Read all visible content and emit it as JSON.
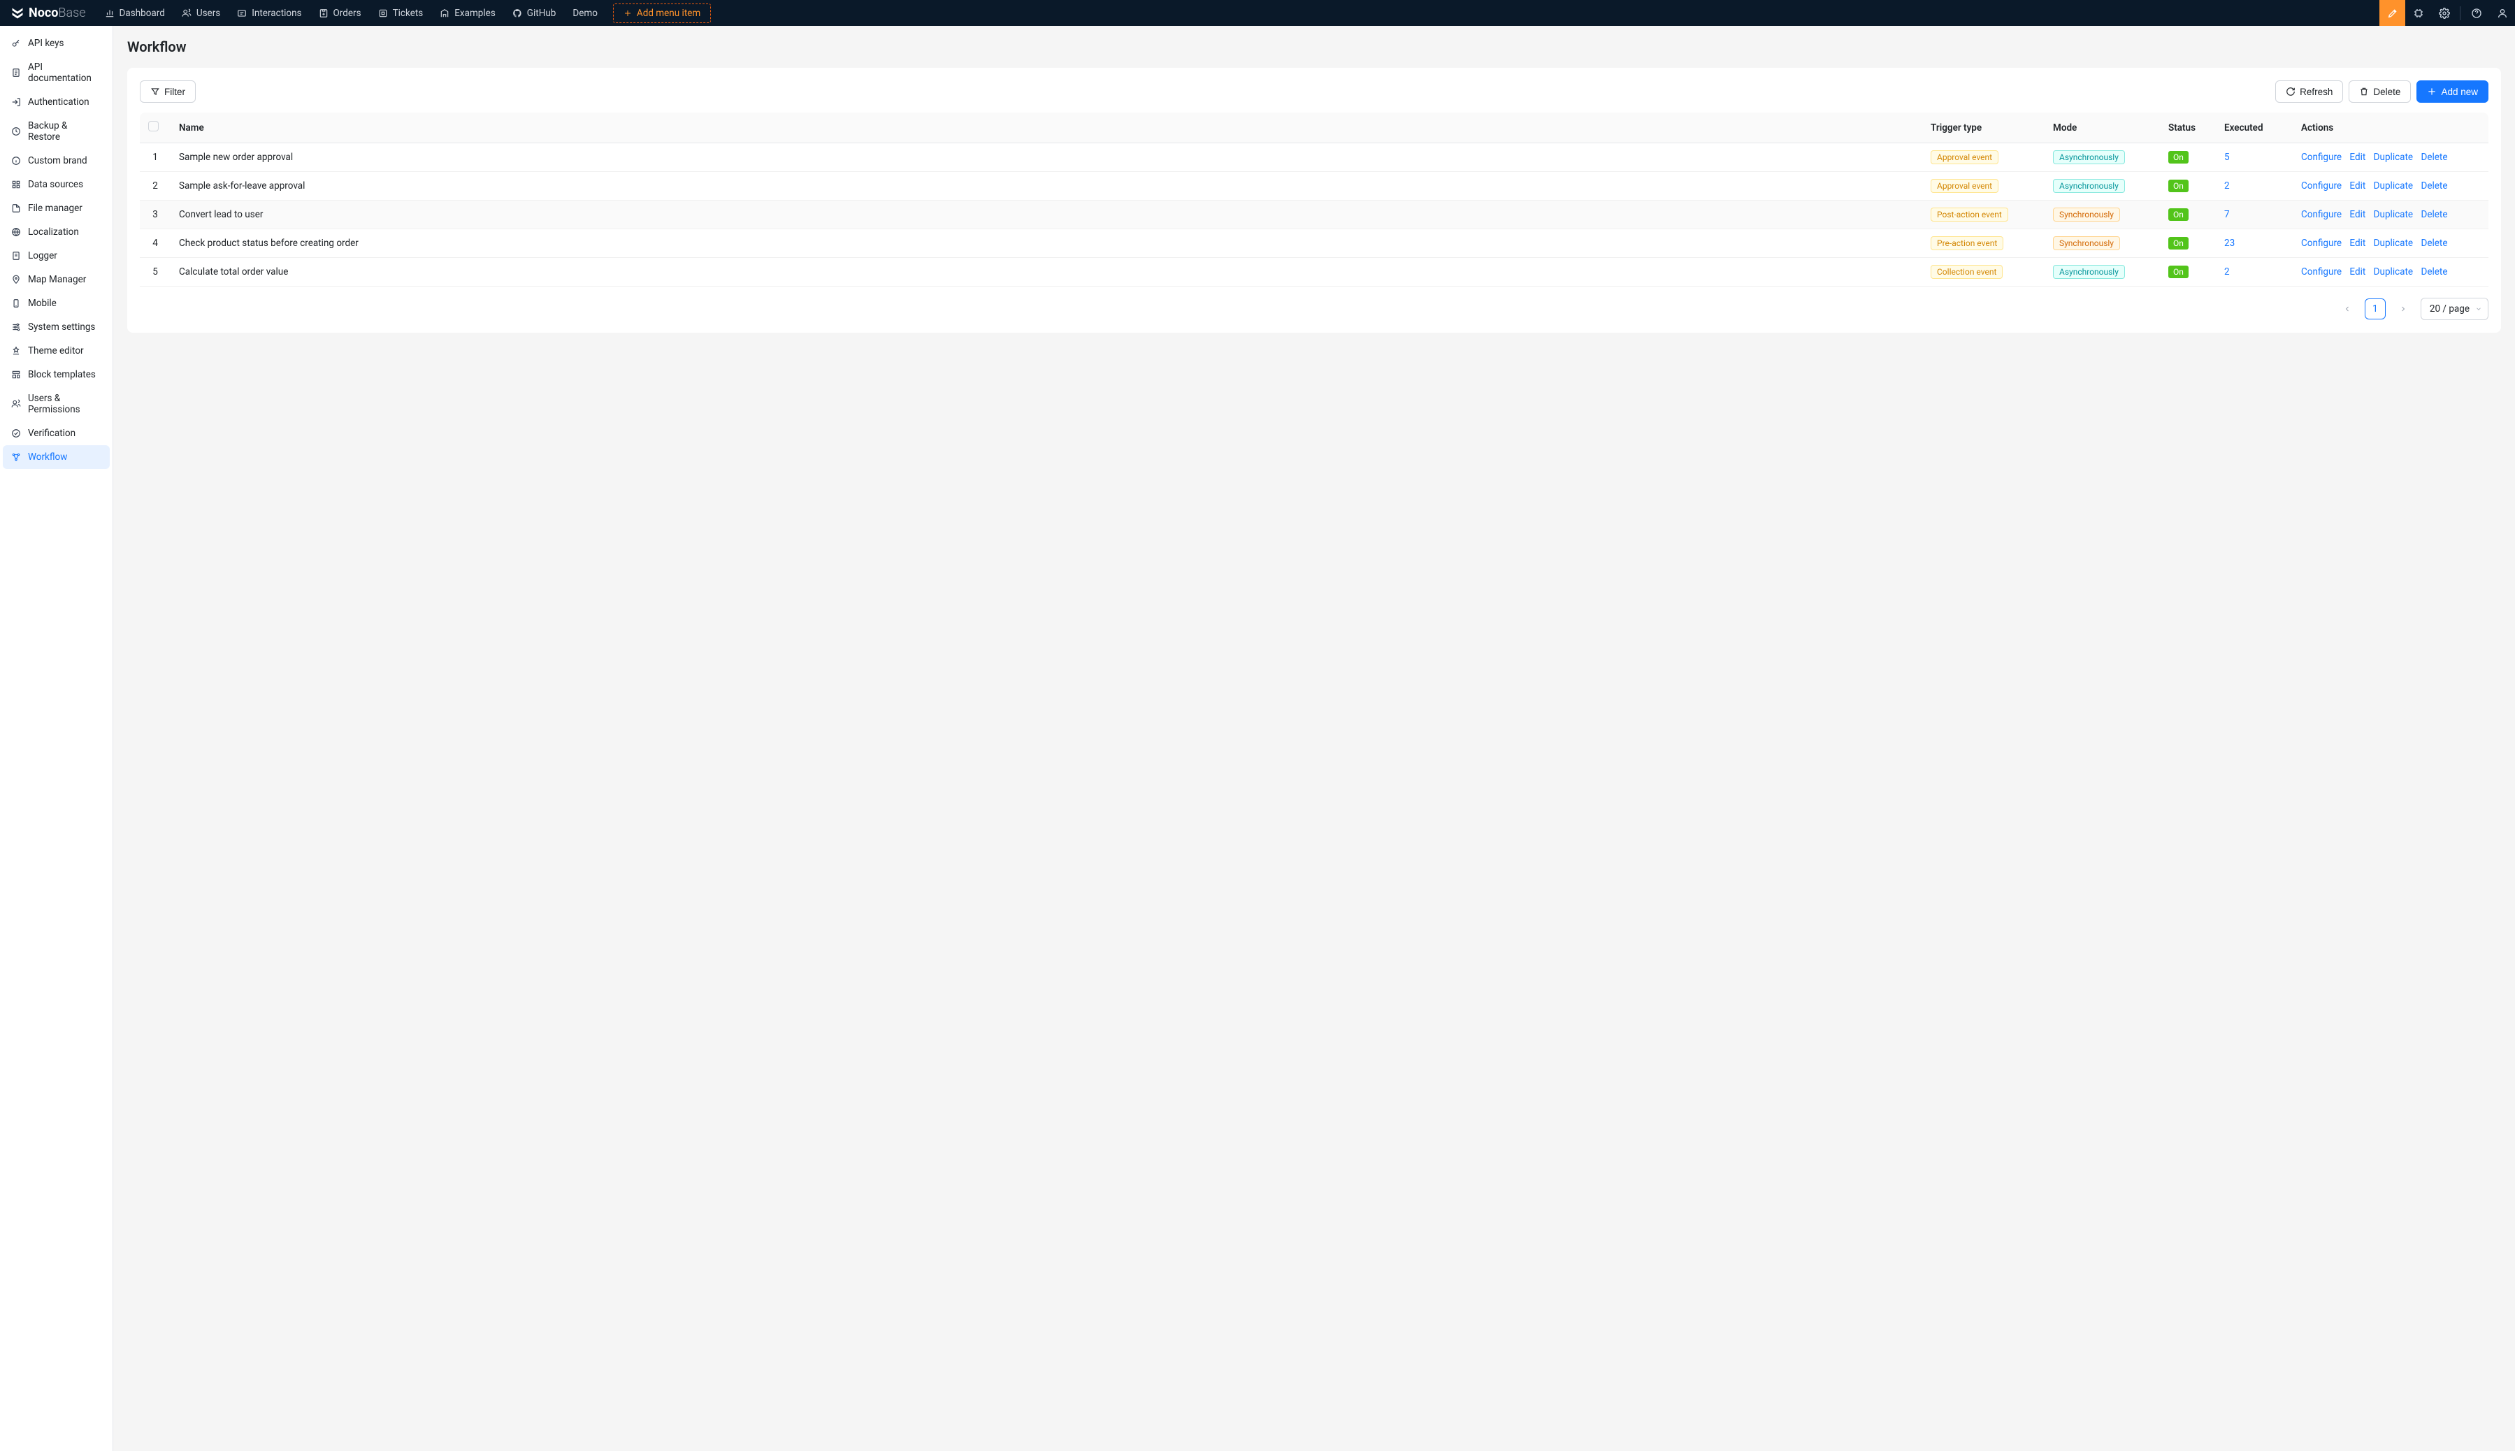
{
  "logo": {
    "bold": "Noco",
    "light": "Base"
  },
  "topnav": {
    "items": [
      {
        "label": "Dashboard"
      },
      {
        "label": "Users"
      },
      {
        "label": "Interactions"
      },
      {
        "label": "Orders"
      },
      {
        "label": "Tickets"
      },
      {
        "label": "Examples"
      },
      {
        "label": "GitHub"
      },
      {
        "label": "Demo"
      }
    ],
    "add_menu": "Add menu item"
  },
  "sidebar": {
    "items": [
      {
        "label": "API keys"
      },
      {
        "label": "API documentation"
      },
      {
        "label": "Authentication"
      },
      {
        "label": "Backup & Restore"
      },
      {
        "label": "Custom brand"
      },
      {
        "label": "Data sources"
      },
      {
        "label": "File manager"
      },
      {
        "label": "Localization"
      },
      {
        "label": "Logger"
      },
      {
        "label": "Map Manager"
      },
      {
        "label": "Mobile"
      },
      {
        "label": "System settings"
      },
      {
        "label": "Theme editor"
      },
      {
        "label": "Block templates"
      },
      {
        "label": "Users & Permissions"
      },
      {
        "label": "Verification"
      },
      {
        "label": "Workflow"
      }
    ]
  },
  "page": {
    "title": "Workflow"
  },
  "toolbar": {
    "filter": "Filter",
    "refresh": "Refresh",
    "delete": "Delete",
    "add_new": "Add new"
  },
  "table": {
    "headers": {
      "name": "Name",
      "trigger": "Trigger type",
      "mode": "Mode",
      "status": "Status",
      "executed": "Executed",
      "actions": "Actions"
    },
    "rows": [
      {
        "idx": "1",
        "name": "Sample new order approval",
        "trigger": "Approval event",
        "trigger_cls": "tag-approval",
        "mode": "Asynchronously",
        "mode_cls": "tag-async",
        "status": "On",
        "executed": "5"
      },
      {
        "idx": "2",
        "name": "Sample ask-for-leave approval",
        "trigger": "Approval event",
        "trigger_cls": "tag-approval",
        "mode": "Asynchronously",
        "mode_cls": "tag-async",
        "status": "On",
        "executed": "2"
      },
      {
        "idx": "3",
        "name": "Convert lead to user",
        "trigger": "Post-action event",
        "trigger_cls": "tag-postaction",
        "mode": "Synchronously",
        "mode_cls": "tag-sync",
        "status": "On",
        "executed": "7",
        "hovered": true
      },
      {
        "idx": "4",
        "name": "Check product status before creating order",
        "trigger": "Pre-action event",
        "trigger_cls": "tag-preaction",
        "mode": "Synchronously",
        "mode_cls": "tag-sync",
        "status": "On",
        "executed": "23"
      },
      {
        "idx": "5",
        "name": "Calculate total order value",
        "trigger": "Collection event",
        "trigger_cls": "tag-collection",
        "mode": "Asynchronously",
        "mode_cls": "tag-async",
        "status": "On",
        "executed": "2"
      }
    ],
    "actions": {
      "configure": "Configure",
      "edit": "Edit",
      "duplicate": "Duplicate",
      "delete": "Delete"
    }
  },
  "pagination": {
    "current": "1",
    "page_size": "20 / page"
  }
}
